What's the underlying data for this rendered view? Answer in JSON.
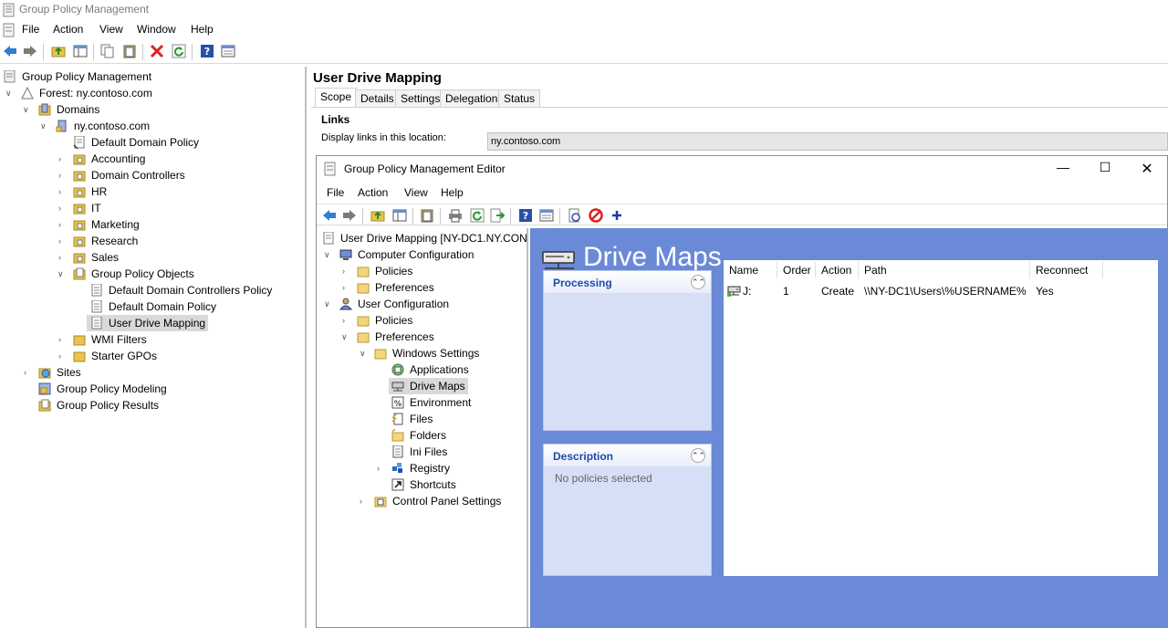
{
  "window": {
    "title": "Group Policy Management"
  },
  "menu": [
    "File",
    "Action",
    "View",
    "Window",
    "Help"
  ],
  "tree": {
    "root": "Group Policy Management",
    "forest": "Forest: ny.contoso.com",
    "domains": "Domains",
    "domain": "ny.contoso.com",
    "items": [
      "Default Domain Policy",
      "Accounting",
      "Domain Controllers",
      "HR",
      "IT",
      "Marketing",
      "Research",
      "Sales",
      "Group Policy Objects"
    ],
    "gpos": [
      "Default Domain Controllers Policy",
      "Default Domain Policy",
      "User Drive Mapping"
    ],
    "after": [
      "WMI Filters",
      "Starter GPOs"
    ],
    "sites": "Sites",
    "modeling": "Group Policy Modeling",
    "results": "Group Policy Results"
  },
  "gpo": {
    "title": "User Drive Mapping",
    "tabs": [
      "Scope",
      "Details",
      "Settings",
      "Delegation",
      "Status"
    ],
    "links_heading": "Links",
    "display_label": "Display links in this location:",
    "display_value": "ny.contoso.com"
  },
  "editor": {
    "title": "Group Policy Management Editor",
    "menu": [
      "File",
      "Action",
      "View",
      "Help"
    ],
    "tree": {
      "root": "User Drive Mapping [NY-DC1.NY.CON",
      "computer": "Computer Configuration",
      "policies": "Policies",
      "preferences": "Preferences",
      "user": "User Configuration",
      "windows_settings": "Windows Settings",
      "ws_items": [
        "Applications",
        "Drive Maps",
        "Environment",
        "Files",
        "Folders",
        "Ini Files",
        "Registry",
        "Shortcuts"
      ],
      "control_panel": "Control Panel Settings"
    },
    "content": {
      "heading": "Drive Maps",
      "processing": "Processing",
      "description": "Description",
      "no_policies": "No policies selected",
      "columns": [
        "Name",
        "Order",
        "Action",
        "Path",
        "Reconnect"
      ],
      "rows": [
        {
          "name": "J:",
          "order": "1",
          "action": "Create",
          "path": "\\\\NY-DC1\\Users\\%USERNAME%",
          "reconnect": "Yes"
        }
      ]
    }
  }
}
